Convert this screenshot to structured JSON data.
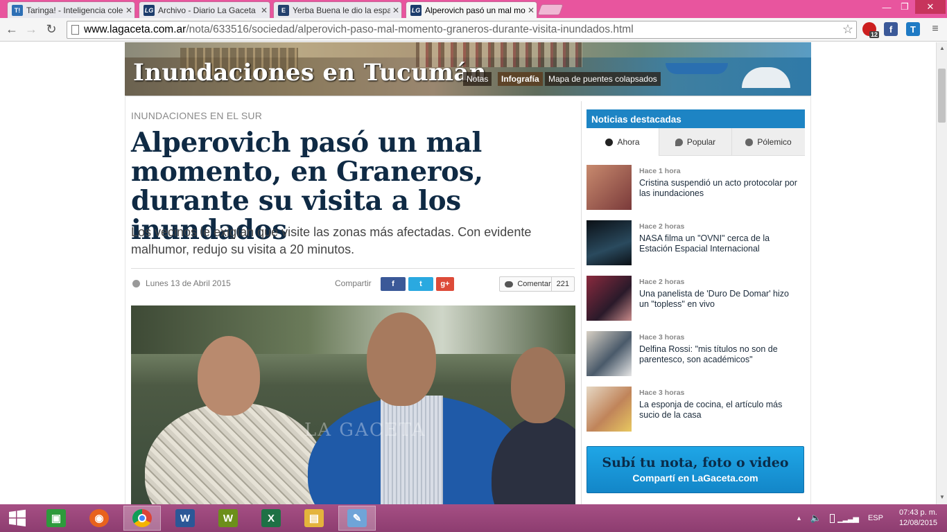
{
  "browser": {
    "tabs": [
      {
        "title": "Taringa! - Inteligencia colectiva",
        "favicon": "T!",
        "color": "#2d6fb5",
        "active": false
      },
      {
        "title": "Archivo - Diario La Gaceta",
        "favicon": "LG",
        "color": "#1c3c6c",
        "active": false
      },
      {
        "title": "Yerba Buena le dio la espalda",
        "favicon": "E",
        "color": "#24416e",
        "active": false
      },
      {
        "title": "Alperovich pasó un mal momento",
        "favicon": "LG",
        "color": "#1c3c6c",
        "active": true
      }
    ],
    "url_domain": "www.lagaceta.com.ar",
    "url_path": "/nota/633516/sociedad/alperovich-paso-mal-momento-graneros-durante-visita-inundados.html",
    "ext_badge": "12"
  },
  "banner": {
    "title": "Inundaciones en Tucumán",
    "nav": [
      "Notas",
      "Infografía",
      "Mapa de puentes colapsados"
    ]
  },
  "article": {
    "kicker": "INUNDACIONES EN EL SUR",
    "headline": "Alperovich pasó un mal momento, en Graneros, durante su visita a los inundados",
    "deck": "Los vecinos le exigían que visite las zonas más afectadas. Con evidente malhumor, redujo su visita a 20 minutos.",
    "date": "Lunes 13 de Abril 2015",
    "share_label": "Compartir",
    "share_buttons": [
      {
        "label": "f",
        "icon": "facebook-icon",
        "color": "#3b5998"
      },
      {
        "label": "t",
        "icon": "twitter-icon",
        "color": "#2aa9e0"
      },
      {
        "label": "g+",
        "icon": "google-plus-icon",
        "color": "#dd4b39"
      }
    ],
    "comment_label": "Comentar",
    "comment_count": "221",
    "photo_watermark": "LA GACETA"
  },
  "sidebar": {
    "header": "Noticias destacadas",
    "tabs": [
      "Ahora",
      "Popular",
      "Pólemico"
    ],
    "news": [
      {
        "when": "Hace 1 hora",
        "title": "Cristina suspendió un acto protocolar por las inundaciones",
        "thumb": "#9a5a4e"
      },
      {
        "when": "Hace 2 horas",
        "title": "NASA filma un \"OVNI\" cerca de la Estación Espacial Internacional",
        "thumb": "#1c2a36"
      },
      {
        "when": "Hace 2 horas",
        "title": "Una panelista de 'Duro De Domar' hizo un \"topless\" en vivo",
        "thumb": "#6a2a3a"
      },
      {
        "when": "Hace 3 horas",
        "title": "Delfina Rossi: \"mis títulos no son de parentesco, son académicos\"",
        "thumb": "#5a6a7a"
      },
      {
        "when": "Hace 3 horas",
        "title": "La esponja de cocina, el artículo más sucio de la casa",
        "thumb": "#c7a07a"
      }
    ],
    "promo_line1": "Subí tu nota, foto o video",
    "promo_line2": "Compartí en LaGaceta.com"
  },
  "taskbar": {
    "apps": [
      {
        "name": "store-icon",
        "glyph": "▣",
        "color": "#2e9a3c"
      },
      {
        "name": "firefox-icon",
        "glyph": "◉",
        "color": "#e8621d"
      },
      {
        "name": "chrome-icon",
        "glyph": "◎",
        "color": "#d9342b"
      },
      {
        "name": "word-icon",
        "glyph": "W",
        "color": "#2b5797"
      },
      {
        "name": "wordperfect-icon",
        "glyph": "W",
        "color": "#6c8f1a"
      },
      {
        "name": "excel-icon",
        "glyph": "X",
        "color": "#1e7145"
      },
      {
        "name": "explorer-icon",
        "glyph": "▤",
        "color": "#e4b43c"
      },
      {
        "name": "paint-icon",
        "glyph": "✎",
        "color": "#6fa4d8"
      }
    ],
    "lang": "ESP",
    "time": "07:43 p. m.",
    "date": "12/08/2015"
  }
}
